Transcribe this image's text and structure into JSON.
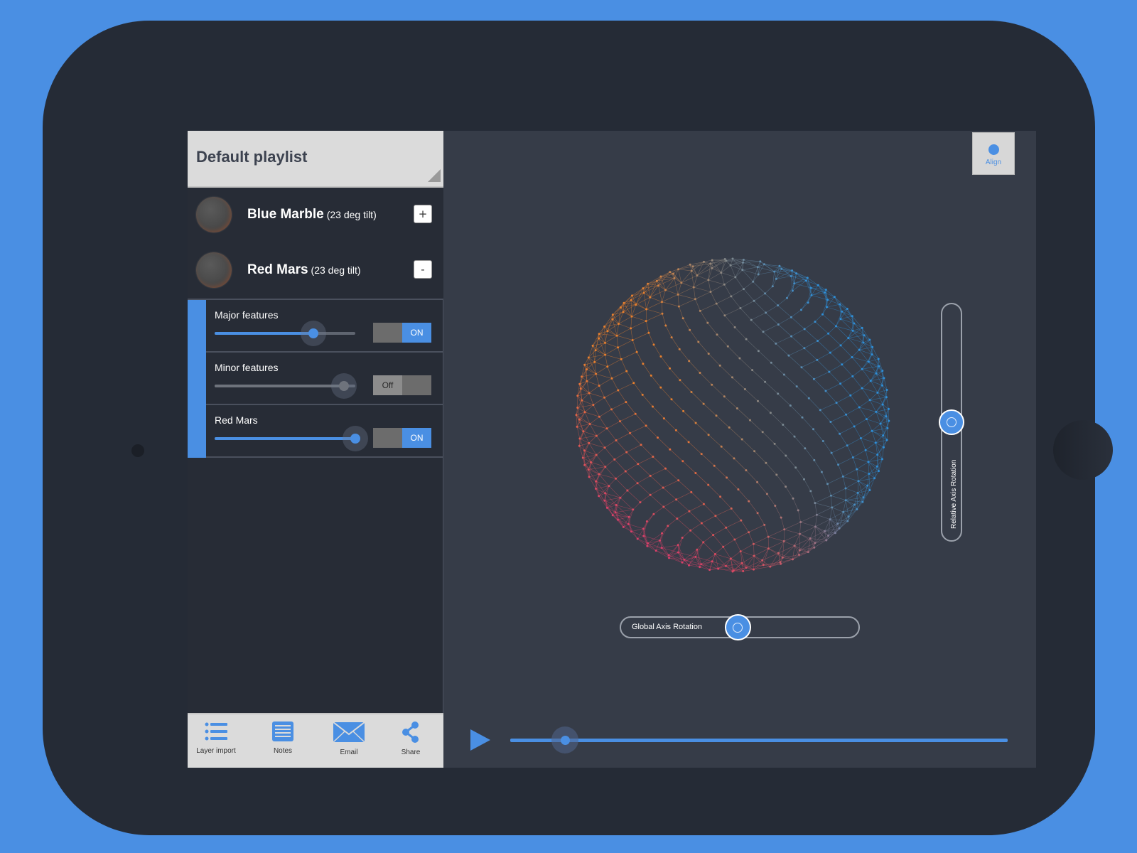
{
  "playlist": {
    "title": "Default playlist",
    "layers": [
      {
        "name": "Blue Marble",
        "sub": "(23 deg tilt)",
        "button": "+"
      },
      {
        "name": "Red Mars",
        "sub": "(23 deg tilt)",
        "button": "-"
      }
    ],
    "sub_layers": [
      {
        "label": "Major features",
        "level": 0.7,
        "toggle_on": "ON",
        "state": "on"
      },
      {
        "label": "Minor features",
        "level": 0.92,
        "toggle_off": "Off",
        "state": "off"
      },
      {
        "label": "Red Mars",
        "level": 1.0,
        "toggle_on": "ON",
        "state": "on"
      }
    ]
  },
  "bottom_bar": {
    "items": [
      {
        "label": "Layer import",
        "icon": "list-icon"
      },
      {
        "label": "Notes",
        "icon": "notes-icon"
      },
      {
        "label": "Email",
        "icon": "email-icon"
      },
      {
        "label": "Share",
        "icon": "share-icon"
      }
    ]
  },
  "viewport": {
    "align_label": "Align",
    "relative_axis_label": "Relative Axis Rotation",
    "global_axis_label": "Global Axis Rotation",
    "relative_axis_level": 0.5,
    "global_axis_level": 0.49,
    "timeline_progress": 0.11
  },
  "colors": {
    "accent": "#4A8FE3",
    "background": "#4A8FE3",
    "device": "#252B36",
    "viewport": "#363C48",
    "sphere_blue": "#2F8FD8",
    "sphere_orange": "#E8802E",
    "sphere_pink": "#D8406A"
  }
}
